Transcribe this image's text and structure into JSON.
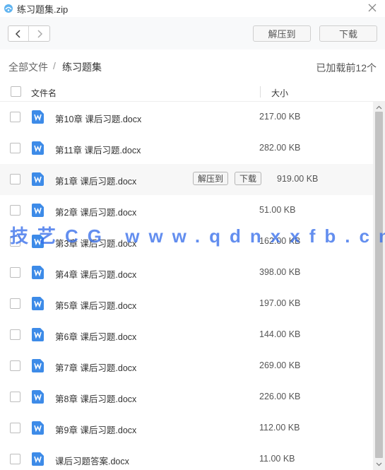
{
  "window": {
    "title": "练习题集.zip"
  },
  "toolbar": {
    "extract_label": "解压到",
    "download_label": "下载"
  },
  "breadcrumb": {
    "root": "全部文件",
    "separator": "/",
    "current": "练习题集"
  },
  "status": {
    "loaded_count": "已加载前12个"
  },
  "list_header": {
    "name": "文件名",
    "size": "大小"
  },
  "row_actions": {
    "extract": "解压到",
    "download": "下载"
  },
  "files": [
    {
      "name": "第10章 课后习题.docx",
      "size": "217.00 KB"
    },
    {
      "name": "第11章 课后习题.docx",
      "size": "282.00 KB"
    },
    {
      "name": "第1章 课后习题.docx",
      "size": "919.00 KB"
    },
    {
      "name": "第2章 课后习题.docx",
      "size": "51.00 KB"
    },
    {
      "name": "第3章 课后习题.docx",
      "size": "162.00 KB"
    },
    {
      "name": "第4章 课后习题.docx",
      "size": "398.00 KB"
    },
    {
      "name": "第5章 课后习题.docx",
      "size": "197.00 KB"
    },
    {
      "name": "第6章 课后习题.docx",
      "size": "144.00 KB"
    },
    {
      "name": "第7章 课后习题.docx",
      "size": "269.00 KB"
    },
    {
      "name": "第8章 课后习题.docx",
      "size": "226.00 KB"
    },
    {
      "name": "第9章 课后习题.docx",
      "size": "112.00 KB"
    },
    {
      "name": "课后习题答案.docx",
      "size": "11.00 KB"
    }
  ],
  "watermark": {
    "text": "技艺CG www.qdnxxfb.cn"
  },
  "colors": {
    "accent": "#3a8ee6",
    "word_icon": "#3d8be8",
    "hover_row": "#f7f7f7"
  },
  "icons": {
    "app": "cloud-zip-icon",
    "close": "close-icon",
    "back": "chevron-left-icon",
    "forward": "chevron-right-icon",
    "file": "word-document-icon"
  }
}
